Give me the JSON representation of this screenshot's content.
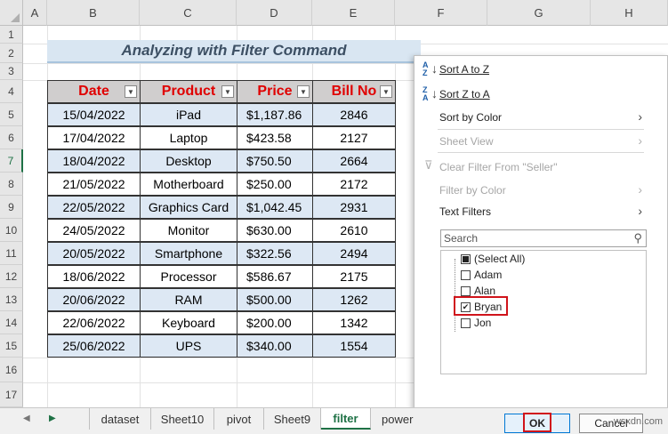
{
  "columns": [
    "A",
    "B",
    "C",
    "D",
    "E",
    "F",
    "G",
    "H"
  ],
  "rows": [
    "1",
    "2",
    "3",
    "4",
    "5",
    "6",
    "7",
    "8",
    "9",
    "10",
    "11",
    "12",
    "13",
    "14",
    "15",
    "16",
    "17"
  ],
  "title": "Analyzing with Filter Command",
  "table": {
    "headers": [
      "Date",
      "Product",
      "Price",
      "Bill No"
    ],
    "rows": [
      [
        "15/04/2022",
        "iPad",
        "$1,187.86",
        "2846"
      ],
      [
        "17/04/2022",
        "Laptop",
        "$423.58",
        "2127"
      ],
      [
        "18/04/2022",
        "Desktop",
        "$750.50",
        "2664"
      ],
      [
        "21/05/2022",
        "Motherboard",
        "$250.00",
        "2172"
      ],
      [
        "22/05/2022",
        "Graphics Card",
        "$1,042.45",
        "2931"
      ],
      [
        "24/05/2022",
        "Monitor",
        "$630.00",
        "2610"
      ],
      [
        "20/05/2022",
        "Smartphone",
        "$322.56",
        "2494"
      ],
      [
        "18/06/2022",
        "Processor",
        "$586.67",
        "2175"
      ],
      [
        "20/06/2022",
        "RAM",
        "$500.00",
        "1262"
      ],
      [
        "22/06/2022",
        "Keyboard",
        "$200.00",
        "1342"
      ],
      [
        "25/06/2022",
        "UPS",
        "$340.00",
        "1554"
      ]
    ]
  },
  "menu": {
    "sort_az": "Sort A to Z",
    "sort_za": "Sort Z to A",
    "sort_by_color": "Sort by Color",
    "sheet_view": "Sheet View",
    "clear_filter": "Clear Filter From \"Seller\"",
    "filter_by_color": "Filter by Color",
    "text_filters": "Text Filters",
    "search_placeholder": "Search",
    "items": [
      {
        "label": "(Select All)",
        "state": "partial"
      },
      {
        "label": "Adam",
        "state": "unchecked"
      },
      {
        "label": "Alan",
        "state": "unchecked"
      },
      {
        "label": "Bryan",
        "state": "checked"
      },
      {
        "label": "Jon",
        "state": "unchecked"
      }
    ],
    "ok_label": "OK",
    "cancel_label": "Cancel"
  },
  "tabs": [
    "dataset",
    "Sheet10",
    "pivot",
    "Sheet9",
    "filter",
    "power"
  ],
  "active_tab": "filter",
  "watermark": "wsxdn.com",
  "colors": {
    "header_text": "#e00000",
    "accent": "#1e7145",
    "highlight": "#d0141b",
    "band": "#dde8f4"
  }
}
